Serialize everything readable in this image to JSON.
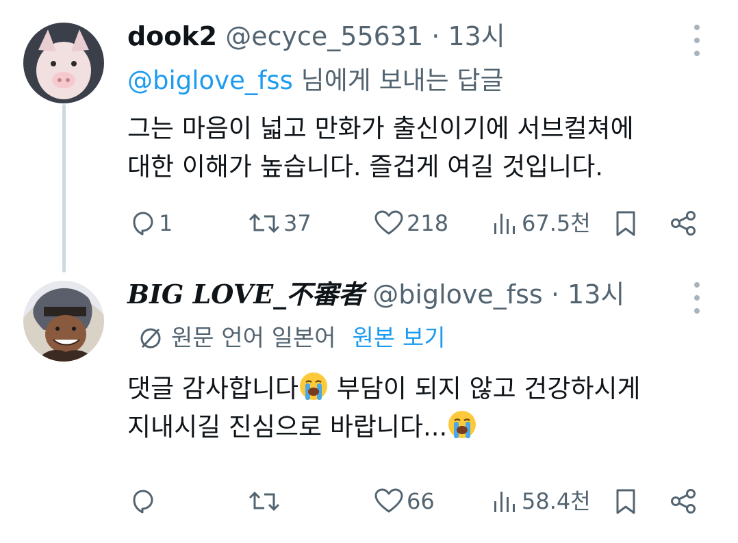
{
  "tweet1": {
    "display_name": "dook2",
    "handle": "@ecyce_55631",
    "separator": "·",
    "time": "13시",
    "reply_to_handle": "@biglove_fss",
    "reply_to_suffix": " 님에게 보내는 답글",
    "text_line1": "그는 마음이 넓고 만화가 출신이기에 서브컬쳐에",
    "text_line2": "대한 이해가 높습니다. 즐겁게 여길 것입니다.",
    "actions": {
      "reply_icon": "reply-icon",
      "reply_count": "1",
      "retweet_icon": "retweet-icon",
      "retweet_count": "37",
      "like_icon": "heart-icon",
      "like_count": "218",
      "views_icon": "views-icon",
      "views_count": "67.5천",
      "bookmark_icon": "bookmark-icon",
      "share_icon": "share-icon"
    }
  },
  "tweet2": {
    "display_name": "BIG LOVE_不審者",
    "handle": "@biglove_fss",
    "separator": "·",
    "time": "13시",
    "translate_icon": "translate-icon",
    "language_note": "원문 언어 일본어",
    "show_original": "원본 보기",
    "text_line1_a": "댓글 감사합니다",
    "text_line1_b": " 부담이 되지 않고 건강하시게",
    "text_line2_a": "지내시길 진심으로 바랍니다...",
    "emoji": "loudly-crying-face",
    "actions": {
      "reply_icon": "reply-icon",
      "retweet_icon": "retweet-icon",
      "like_icon": "heart-icon",
      "like_count": "66",
      "views_icon": "views-icon",
      "views_count": "58.4천",
      "bookmark_icon": "bookmark-icon",
      "share_icon": "share-icon"
    }
  },
  "colors": {
    "link": "#1d9bf0",
    "meta_gray": "#536471",
    "text": "#0f1419",
    "thread_line": "#cfd9de"
  }
}
